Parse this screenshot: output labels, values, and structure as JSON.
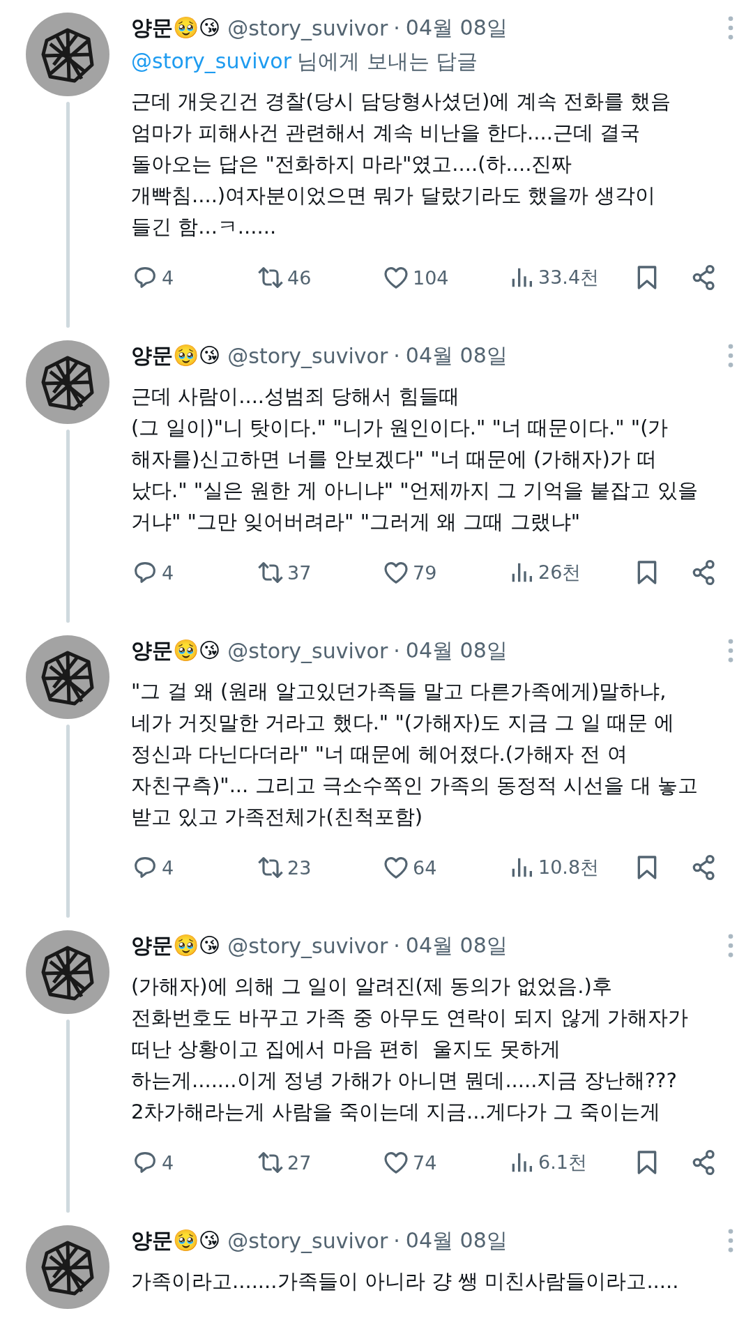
{
  "tweets": [
    {
      "name": "양문🥹😘",
      "handle": "@story_suvivor",
      "separator": "·",
      "date": "04월 08일",
      "reply_to": {
        "handle": "@story_suvivor",
        "text": "님에게 보내는 답글"
      },
      "lines": [
        "근데 개웃긴건 경찰(당시 담당형사셨던)에 계속 전화를 했음",
        "엄마가 피해사건 관련해서 계속 비난을 한다....근데 결국",
        "돌아오는 답은 \"전화하지 마라\"였고....(하....진짜",
        "개빡침....)여자분이었으면 뭐가 달랐기라도 했을까 생각이",
        "들긴 함...ㅋ......"
      ],
      "stats": {
        "replies": "4",
        "retweets": "46",
        "likes": "104",
        "views": "33.4천"
      }
    },
    {
      "name": "양문🥹😘",
      "handle": "@story_suvivor",
      "separator": "·",
      "date": "04월 08일",
      "lines": [
        "근데 사람이....성범죄 당해서 힘들때",
        "(그 일이)\"니 탓이다.\" \"니가 원인이다.\" \"너 때문이다.\" \"(가",
        "해자를)신고하면 너를 안보겠다\" \"너 때문에 (가해자)가 떠",
        "났다.\" \"실은 원한 게 아니냐\" \"언제까지 그 기억을 붙잡고 있을",
        "거냐\" \"그만 잊어버려라\" \"그러게 왜 그때 그랬냐\""
      ],
      "stats": {
        "replies": "4",
        "retweets": "37",
        "likes": "79",
        "views": "26천"
      }
    },
    {
      "name": "양문🥹😘",
      "handle": "@story_suvivor",
      "separator": "·",
      "date": "04월 08일",
      "lines": [
        "\"그 걸 왜 (원래 알고있던가족들 말고 다른가족에게)말하냐,",
        "네가 거짓말한 거라고 했다.\" \"(가해자)도 지금 그 일 때문 에",
        "정신과 다닌다더라\" \"너 때문에 헤어졌다.(가해자 전 여",
        "자친구측)\"... 그리고 극소수쪽인 가족의 동정적 시선을 대 놓고",
        "받고 있고 가족전체가(친척포함)"
      ],
      "stats": {
        "replies": "4",
        "retweets": "23",
        "likes": "64",
        "views": "10.8천"
      }
    },
    {
      "name": "양문🥹😘",
      "handle": "@story_suvivor",
      "separator": "·",
      "date": "04월 08일",
      "lines": [
        "(가해자)에 의해 그 일이 알려진(제 동의가 없었음.)후",
        "전화번호도 바꾸고 가족 중 아무도 연락이 되지 않게 가해자가",
        "떠난 상황이고 집에서 마음 편히  울지도 못하게",
        "하는게.......이게 정녕 가해가 아니면 뭔데.....지금 장난해???",
        "2차가해라는게 사람을 죽이는데 지금...게다가 그 죽이는게"
      ],
      "stats": {
        "replies": "4",
        "retweets": "27",
        "likes": "74",
        "views": "6.1천"
      }
    },
    {
      "name": "양문🥹😘",
      "handle": "@story_suvivor",
      "separator": "·",
      "date": "04월 08일",
      "lines": [
        "가족이라고.......가족들이 아니라 걍 쌩 미친사람들이라고....."
      ]
    }
  ]
}
